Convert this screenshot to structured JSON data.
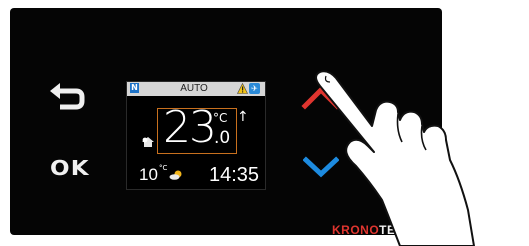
{
  "controls": {
    "back_icon": "return-arrow-icon",
    "ok_label": "OK",
    "up_icon": "chevron-up-icon",
    "down_icon": "chevron-down-icon"
  },
  "display": {
    "status_icon_left": "N",
    "mode": "AUTO",
    "warning_icon": "warning-icon",
    "connectivity_icon": "satellite-icon",
    "room_temp_int": "23",
    "room_temp_unit": "°C",
    "room_temp_dec": ".0",
    "trend_arrow": "↑",
    "outdoor_temp": "10",
    "outdoor_unit": "°C",
    "clock": "14:35"
  },
  "brand": {
    "part_a": "KRONO",
    "part_b": "TERM"
  },
  "colors": {
    "panel": "#050505",
    "accent_up": "#e0352f",
    "accent_down": "#1d8be0",
    "frame": "#c8701e"
  }
}
